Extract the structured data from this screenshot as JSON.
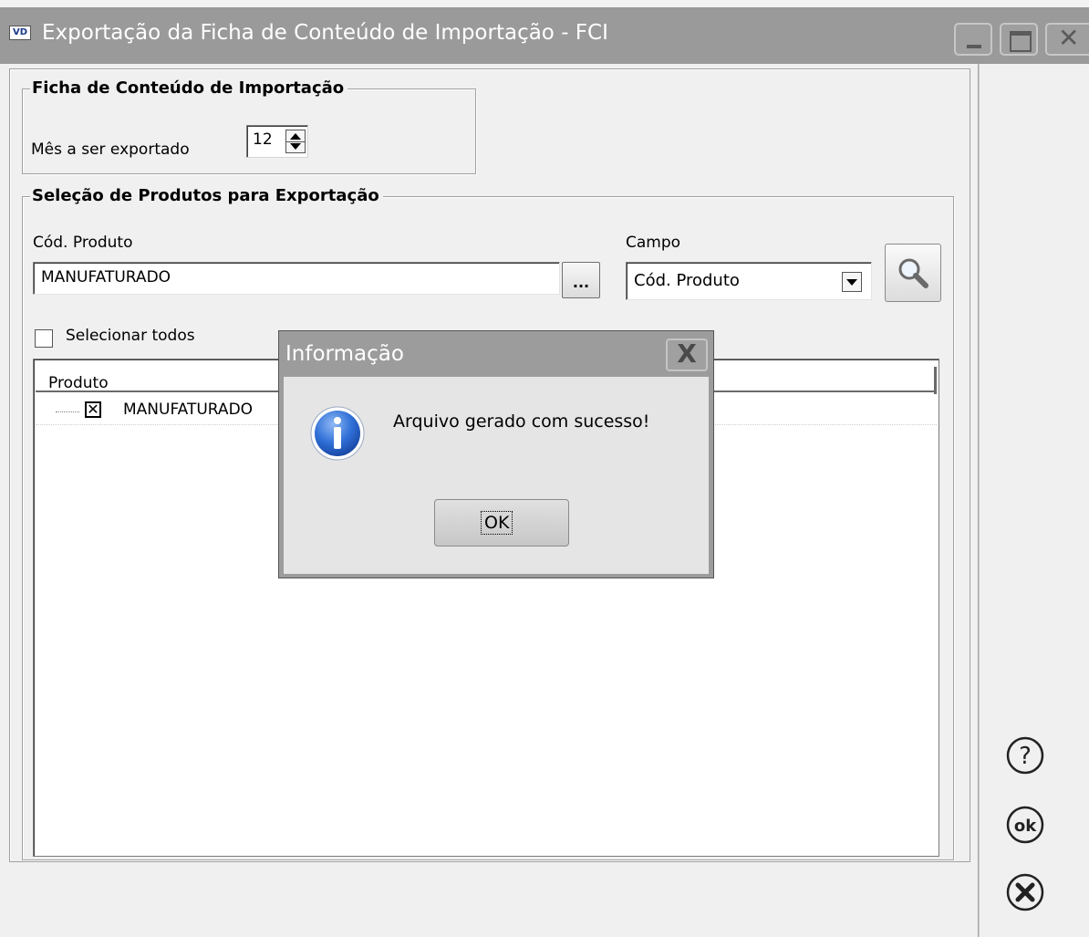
{
  "window": {
    "app_icon_text": "VD",
    "title": "Exportação da Ficha de Conteúdo de Importação - FCI"
  },
  "group_ficha": {
    "legend": "Ficha de Conteúdo de Importação",
    "month_label": "Mês a ser exportado",
    "month_value": "12"
  },
  "group_selecao": {
    "legend": "Seleção de Produtos para Exportação",
    "product_code_label": "Cód. Produto",
    "product_code_value": "MANUFATURADO",
    "browse_button": "...",
    "field_label": "Campo",
    "field_value": "Cód. Produto",
    "select_all_label": "Selecionar todos",
    "select_all_checked": false
  },
  "grid": {
    "column_header": "Produto",
    "rows": [
      {
        "label": "MANUFATURADO",
        "checked": true,
        "check_glyph": "✕"
      }
    ]
  },
  "dialog": {
    "title": "Informação",
    "message": "Arquivo gerado com sucesso!",
    "ok_label": "OK",
    "close_glyph": "X"
  },
  "side_actions": [
    "help-icon",
    "ok-icon",
    "cancel-icon"
  ],
  "colors": {
    "titlebar": "#9a9a9a",
    "background": "#f0f0f0",
    "info_icon": "#2f6fd6"
  }
}
